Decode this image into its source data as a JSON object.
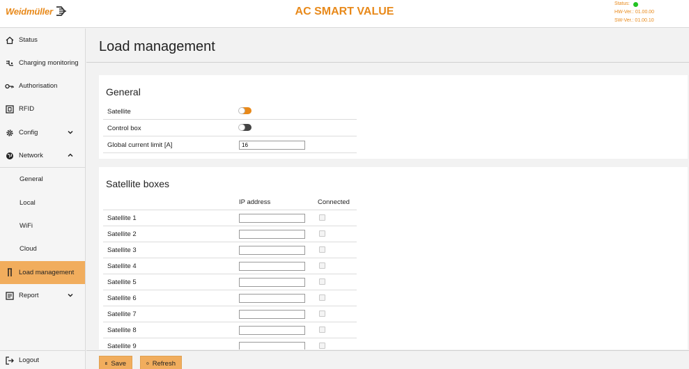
{
  "header": {
    "brand": "Weidmüller",
    "app_title": "AC SMART VALUE",
    "status_label": "Status:",
    "hw_version": "HW-Ver.: 01.00.00",
    "sw_version": "SW-Ver.: 01.00.10",
    "status_color": "#22c322"
  },
  "sidebar": {
    "items": [
      {
        "label": "Status",
        "icon": "home-icon"
      },
      {
        "label": "Charging monitoring",
        "icon": "charging-plug-icon"
      },
      {
        "label": "Authorisation",
        "icon": "key-icon"
      },
      {
        "label": "RFID",
        "icon": "rfid-card-icon"
      },
      {
        "label": "Config",
        "icon": "gear-icon"
      },
      {
        "label": "Network",
        "icon": "globe-icon"
      },
      {
        "label": "General"
      },
      {
        "label": "Local"
      },
      {
        "label": "WiFi"
      },
      {
        "label": "Cloud"
      },
      {
        "label": "Load management",
        "icon": "load-tower-icon",
        "active": true
      },
      {
        "label": "Report",
        "icon": "report-icon"
      }
    ],
    "logout_label": "Logout"
  },
  "main": {
    "page_title": "Load management",
    "general": {
      "title": "General",
      "satellite_label": "Satellite",
      "satellite_on": true,
      "control_box_label": "Control box",
      "control_box_on": false,
      "current_limit_label": "Global current limit [A]",
      "current_limit_value": "16"
    },
    "satellites": {
      "title": "Satellite boxes",
      "col_ip": "IP address",
      "col_connected": "Connected",
      "rows": [
        {
          "label": "Satellite 1",
          "ip": ""
        },
        {
          "label": "Satellite 2",
          "ip": ""
        },
        {
          "label": "Satellite 3",
          "ip": ""
        },
        {
          "label": "Satellite 4",
          "ip": ""
        },
        {
          "label": "Satellite 5",
          "ip": ""
        },
        {
          "label": "Satellite 6",
          "ip": ""
        },
        {
          "label": "Satellite 7",
          "ip": ""
        },
        {
          "label": "Satellite 8",
          "ip": ""
        },
        {
          "label": "Satellite 9",
          "ip": ""
        }
      ]
    }
  },
  "buttons": {
    "save": "Save",
    "refresh": "Refresh"
  },
  "colors": {
    "accent": "#e8891a",
    "active_nav": "#f1ad5d"
  }
}
